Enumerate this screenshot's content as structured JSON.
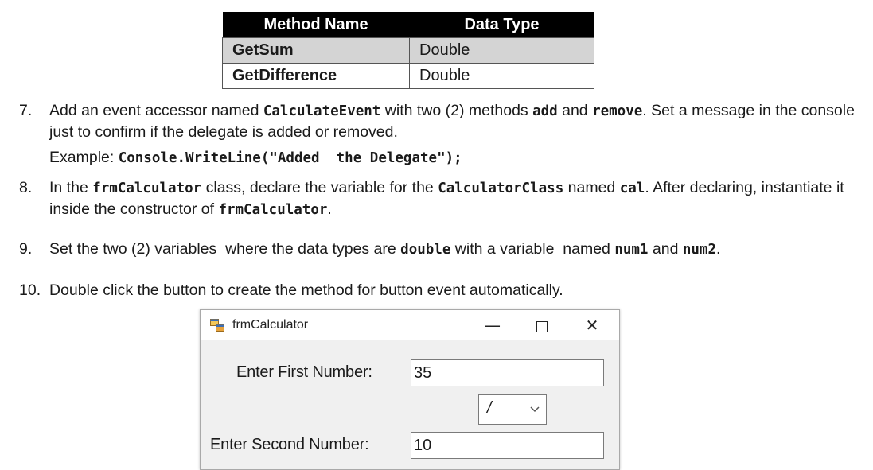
{
  "table": {
    "headers": [
      "Method Name",
      "Data Type"
    ],
    "rows": [
      {
        "name": "GetSum",
        "type": "Double"
      },
      {
        "name": "GetDifference",
        "type": "Double"
      }
    ]
  },
  "steps": {
    "s7": {
      "num": "7.",
      "t1": "Add an event accessor named ",
      "c1": "CalculateEvent",
      "t2": " with two (2) methods ",
      "c2": "add",
      "t3": " and ",
      "c3": "remove",
      "t4": ". Set a message in the console just to confirm if the delegate is added or removed.",
      "example_label": "Example: ",
      "example_code": "Console.WriteLine(\"Added  the Delegate\");"
    },
    "s8": {
      "num": "8.",
      "t1": "In the ",
      "c1": "frmCalculator",
      "t2": " class, declare the variable for the ",
      "c2": "CalculatorClass",
      "t3": " named ",
      "c3": "cal",
      "t4": ". After declaring, instantiate it inside the constructor of ",
      "c4": "frmCalculator",
      "t5": "."
    },
    "s9": {
      "num": "9.",
      "t1": "Set the two (2) variables  where the data types are ",
      "c1": "double",
      "t2": " with a variable  named ",
      "c2": "num1",
      "t3": " and ",
      "c3": "num2",
      "t4": "."
    },
    "s10": {
      "num": "10.",
      "t1": "Double click the button to create the method for button event automatically."
    }
  },
  "window": {
    "title": "frmCalculator",
    "min_glyph": "—",
    "close_glyph": "✕",
    "first_label": "Enter First Number:",
    "first_value": "35",
    "operator_value": "/",
    "second_label": "Enter Second Number:",
    "second_value": "10",
    "icons": [
      "form-app-icon",
      "minimize-icon",
      "maximize-icon",
      "close-icon",
      "chevron-down-icon"
    ]
  }
}
